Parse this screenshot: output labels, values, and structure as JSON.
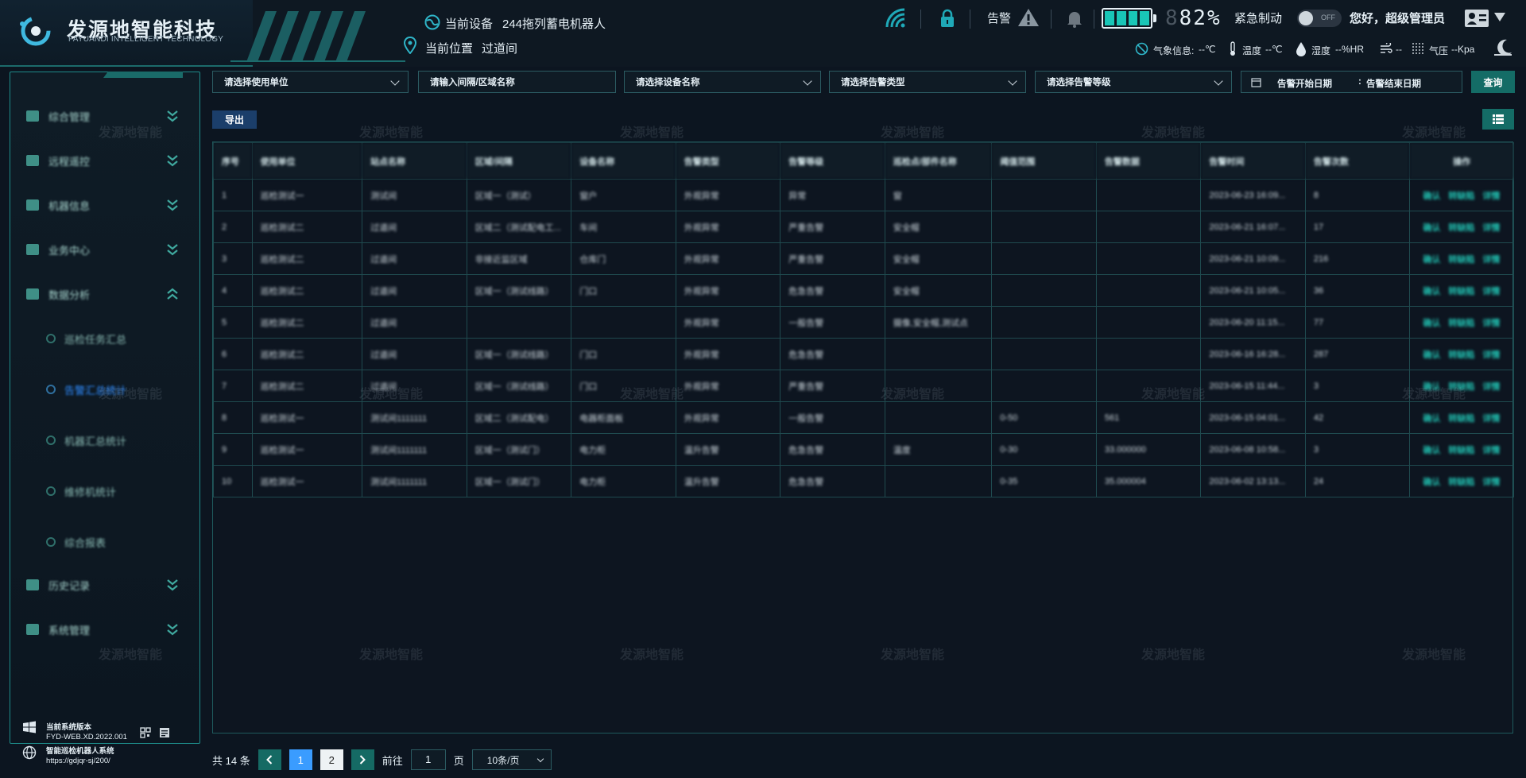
{
  "brand": {
    "name_cn": "发源地智能科技",
    "name_en": "FAYUANDI INTELLIGENT TECHNOLOGY"
  },
  "header": {
    "current_device_label": "当前设备",
    "current_device_value": "244拖列蓄电机器人",
    "current_location_label": "当前位置",
    "current_location_value": "过道间",
    "alarm_label": "告警",
    "battery_percent": "82%",
    "battery_value": 0.82,
    "battery_digit_dim": "8",
    "emergency_label": "紧急制动",
    "toggle_text": "OFF",
    "greeting": "您好，超级管理员",
    "weather_label": "气象信息:",
    "weather_temp": "--℃",
    "temp_label": "温度",
    "temp_value": "--℃",
    "humidity_label": "湿度",
    "humidity_value": "--%HR",
    "wind_value": "--",
    "pressure_label": "气压",
    "pressure_value": "--Kpa"
  },
  "sidebar": {
    "items": [
      {
        "label": "综合管理",
        "expanded": false
      },
      {
        "label": "远程遥控",
        "expanded": false
      },
      {
        "label": "机器信息",
        "expanded": false
      },
      {
        "label": "业务中心",
        "expanded": false
      },
      {
        "label": "数据分析",
        "expanded": true
      }
    ],
    "subitems": [
      {
        "label": "巡检任务汇总",
        "active": false
      },
      {
        "label": "告警汇总统计",
        "active": true
      },
      {
        "label": "机器汇总统计",
        "active": false
      },
      {
        "label": "维修机统计",
        "active": false
      },
      {
        "label": "综合报表",
        "active": false
      }
    ],
    "items_bottom": [
      {
        "label": "历史记录",
        "expanded": false
      },
      {
        "label": "系统管理",
        "expanded": false
      }
    ],
    "system": {
      "version_label": "当前系统版本",
      "version": "FYD-WEB.XD.2022.001",
      "system_name": "智能巡检机器人系统",
      "url": "https://gdjqr-sj/200/"
    }
  },
  "filters": {
    "unit": "请选择使用单位",
    "area": "请输入间隔/区域名称",
    "device": "请选择设备名称",
    "alarm_type": "请选择告警类型",
    "alarm_level": "请选择告警等级",
    "start_date": "告警开始日期",
    "date_sep": ":",
    "end_date": "告警结束日期",
    "query": "查询"
  },
  "toolbar": {
    "export": "导出"
  },
  "table": {
    "columns": [
      "序号",
      "使用单位",
      "站点名称",
      "区域/间隔",
      "设备名称",
      "告警类型",
      "告警等级",
      "巡检点/部件名称",
      "阈值范围",
      "告警数据",
      "告警时间",
      "告警次数",
      "操作"
    ],
    "rows": [
      [
        "1",
        "巡检测试一",
        "测试间",
        "区域一（测试）",
        "窗户",
        "外观异常",
        "异常",
        "窗",
        "",
        "",
        "2023-06-23 16:09...",
        "8",
        "确认,转缺陷,详情"
      ],
      [
        "2",
        "巡检测试二",
        "过道间",
        "区域二（测试配电工...",
        "车间",
        "外观异常",
        "严重告警",
        "安全帽",
        "",
        "",
        "2023-06-21 16:07...",
        "17",
        "确认,转缺陷,详情"
      ],
      [
        "3",
        "巡检测试二",
        "过道间",
        "非接近监区域",
        "仓库门",
        "外观异常",
        "严重告警",
        "安全帽",
        "",
        "",
        "2023-06-21 10:09...",
        "216",
        "确认,转缺陷,详情"
      ],
      [
        "4",
        "巡检测试二",
        "过道间",
        "区域一（测试线路）",
        "门口",
        "外观异常",
        "危急告警",
        "安全帽",
        "",
        "",
        "2023-06-21 10:05...",
        "36",
        "确认,转缺陷,详情"
      ],
      [
        "5",
        "巡检测试二",
        "过道间",
        "",
        "",
        "外观异常",
        "一般告警",
        "摄像,安全帽,测试点",
        "",
        "",
        "2023-06-20 11:15...",
        "77",
        "确认,转缺陷,详情"
      ],
      [
        "6",
        "巡检测试二",
        "过道间",
        "区域一（测试线路）",
        "门口",
        "外观异常",
        "危急告警",
        "",
        "",
        "",
        "2023-06-16 16:28...",
        "287",
        "确认,转缺陷,详情"
      ],
      [
        "7",
        "巡检测试二",
        "过道间",
        "区域一（测试线路）",
        "门口",
        "外观异常",
        "严重告警",
        "",
        "",
        "",
        "2023-06-15 11:44...",
        "3",
        "确认,转缺陷,详情"
      ],
      [
        "8",
        "巡检测试一",
        "测试间1111111",
        "区域二（测试配电）",
        "电器柜面板",
        "外观异常",
        "一般告警",
        "",
        "0-50",
        "561",
        "2023-06-15 04:01...",
        "42",
        "确认,转缺陷,详情"
      ],
      [
        "9",
        "巡检测试一",
        "测试间1111111",
        "区域一（测试门）",
        "电力柜",
        "温升告警",
        "危急告警",
        "温度",
        "0-30",
        "33.000000",
        "2023-06-08 10:58...",
        "3",
        "确认,转缺陷,详情"
      ],
      [
        "10",
        "巡检测试一",
        "测试间1111111",
        "区域一（测试门）",
        "电力柜",
        "温升告警",
        "危急告警",
        "",
        "0-35",
        "35.000004",
        "2023-06-02 13:13...",
        "24",
        "确认,转缺陷,详情"
      ]
    ]
  },
  "pagination": {
    "total_prefix": "共",
    "total": "14",
    "total_suffix": "条",
    "pages": [
      "1",
      "2"
    ],
    "current": "1",
    "goto_label": "前往",
    "goto_value": "1",
    "goto_suffix": "页",
    "page_size": "10条/页"
  },
  "watermark": "发源地智能",
  "colors": {
    "accent": "#146c66",
    "link": "#21c0b0",
    "active_page": "#3a9cff",
    "active_menu": "#2f8cff"
  }
}
